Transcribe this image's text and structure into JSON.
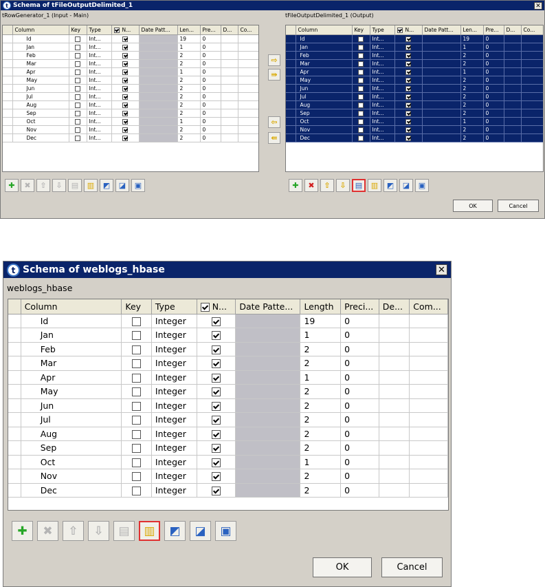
{
  "top_window": {
    "title": "Schema of tFileOutputDelimited_1",
    "close_label": "✕",
    "left_label": "tRowGenerator_1 (Input - Main)",
    "right_label": "tFileOutputDelimited_1 (Output)",
    "columns": [
      "Column",
      "Key",
      "Type",
      "N...",
      "Date Patt...",
      "Len...",
      "Pre...",
      "D...",
      "Co..."
    ],
    "rows": [
      {
        "name": "Id",
        "type": "Int...",
        "key": false,
        "nullable": true,
        "length": "19",
        "precision": "0"
      },
      {
        "name": "Jan",
        "type": "Int...",
        "key": false,
        "nullable": true,
        "length": "1",
        "precision": "0"
      },
      {
        "name": "Feb",
        "type": "Int...",
        "key": false,
        "nullable": true,
        "length": "2",
        "precision": "0"
      },
      {
        "name": "Mar",
        "type": "Int...",
        "key": false,
        "nullable": true,
        "length": "2",
        "precision": "0"
      },
      {
        "name": "Apr",
        "type": "Int...",
        "key": false,
        "nullable": true,
        "length": "1",
        "precision": "0"
      },
      {
        "name": "May",
        "type": "Int...",
        "key": false,
        "nullable": true,
        "length": "2",
        "precision": "0"
      },
      {
        "name": "Jun",
        "type": "Int...",
        "key": false,
        "nullable": true,
        "length": "2",
        "precision": "0"
      },
      {
        "name": "Jul",
        "type": "Int...",
        "key": false,
        "nullable": true,
        "length": "2",
        "precision": "0"
      },
      {
        "name": "Aug",
        "type": "Int...",
        "key": false,
        "nullable": true,
        "length": "2",
        "precision": "0"
      },
      {
        "name": "Sep",
        "type": "Int...",
        "key": false,
        "nullable": true,
        "length": "2",
        "precision": "0"
      },
      {
        "name": "Oct",
        "type": "Int...",
        "key": false,
        "nullable": true,
        "length": "1",
        "precision": "0"
      },
      {
        "name": "Nov",
        "type": "Int...",
        "key": false,
        "nullable": true,
        "length": "2",
        "precision": "0"
      },
      {
        "name": "Dec",
        "type": "Int...",
        "key": false,
        "nullable": true,
        "length": "2",
        "precision": "0"
      }
    ],
    "ok_label": "OK",
    "cancel_label": "Cancel"
  },
  "bottom_window": {
    "title": "Schema of weblogs_hbase",
    "close_label": "✕",
    "schema_label": "weblogs_hbase",
    "columns": [
      "Column",
      "Key",
      "Type",
      "N...",
      "Date Patte...",
      "Length",
      "Preci...",
      "De...",
      "Com..."
    ],
    "rows": [
      {
        "name": "Id",
        "type": "Integer",
        "key": false,
        "nullable": true,
        "length": "19",
        "precision": "0"
      },
      {
        "name": "Jan",
        "type": "Integer",
        "key": false,
        "nullable": true,
        "length": "1",
        "precision": "0"
      },
      {
        "name": "Feb",
        "type": "Integer",
        "key": false,
        "nullable": true,
        "length": "2",
        "precision": "0"
      },
      {
        "name": "Mar",
        "type": "Integer",
        "key": false,
        "nullable": true,
        "length": "2",
        "precision": "0"
      },
      {
        "name": "Apr",
        "type": "Integer",
        "key": false,
        "nullable": true,
        "length": "1",
        "precision": "0"
      },
      {
        "name": "May",
        "type": "Integer",
        "key": false,
        "nullable": true,
        "length": "2",
        "precision": "0"
      },
      {
        "name": "Jun",
        "type": "Integer",
        "key": false,
        "nullable": true,
        "length": "2",
        "precision": "0"
      },
      {
        "name": "Jul",
        "type": "Integer",
        "key": false,
        "nullable": true,
        "length": "2",
        "precision": "0"
      },
      {
        "name": "Aug",
        "type": "Integer",
        "key": false,
        "nullable": true,
        "length": "2",
        "precision": "0"
      },
      {
        "name": "Sep",
        "type": "Integer",
        "key": false,
        "nullable": true,
        "length": "2",
        "precision": "0"
      },
      {
        "name": "Oct",
        "type": "Integer",
        "key": false,
        "nullable": true,
        "length": "1",
        "precision": "0"
      },
      {
        "name": "Nov",
        "type": "Integer",
        "key": false,
        "nullable": true,
        "length": "2",
        "precision": "0"
      },
      {
        "name": "Dec",
        "type": "Integer",
        "key": false,
        "nullable": true,
        "length": "2",
        "precision": "0"
      }
    ],
    "ok_label": "OK",
    "cancel_label": "Cancel"
  },
  "toolbar_icons": [
    {
      "name": "add-icon",
      "glyph": "✚"
    },
    {
      "name": "remove-icon",
      "glyph": "✖"
    },
    {
      "name": "move-up-icon",
      "glyph": "⇧"
    },
    {
      "name": "move-down-icon",
      "glyph": "⇩"
    },
    {
      "name": "copy-icon",
      "glyph": "▤"
    },
    {
      "name": "paste-icon",
      "glyph": "▥"
    },
    {
      "name": "import-icon",
      "glyph": "◩"
    },
    {
      "name": "export-icon",
      "glyph": "◪"
    },
    {
      "name": "save-icon",
      "glyph": "▣"
    }
  ],
  "colors": {
    "title_bar": "#0a246a",
    "selection": "#0a246a",
    "dialog_bg": "#d4d0c8",
    "highlight": "#e03030"
  }
}
